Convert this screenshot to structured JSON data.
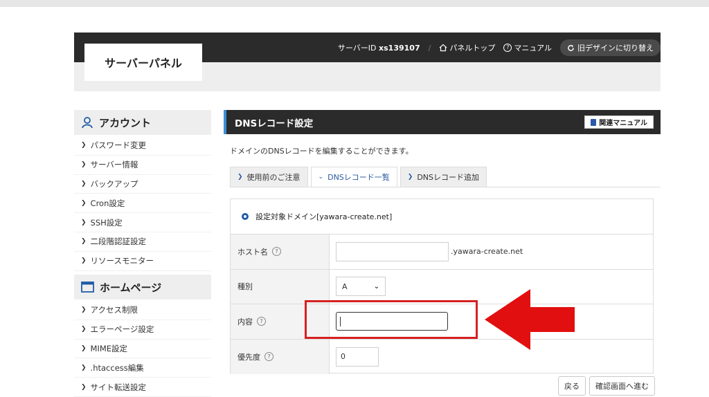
{
  "header": {
    "logo": "サーバーパネル",
    "server_id_label": "サーバーID",
    "server_id": "xs139107",
    "panel_top": "パネルトップ",
    "manual": "マニュアル",
    "old_design": "旧デザインに切り替え"
  },
  "sidebar": {
    "account_heading": "アカウント",
    "account_items": [
      "パスワード変更",
      "サーバー情報",
      "バックアップ",
      "Cron設定",
      "SSH設定",
      "二段階認証設定",
      "リソースモニター"
    ],
    "homepage_heading": "ホームページ",
    "homepage_items": [
      "アクセス制限",
      "エラーページ設定",
      "MIME設定",
      ".htaccess編集",
      "サイト転送設定"
    ]
  },
  "main": {
    "title": "DNSレコード設定",
    "related_manual": "関連マニュアル",
    "description": "ドメインのDNSレコードを編集することができます。",
    "tabs": [
      "使用前のご注意",
      "DNSレコード一覧",
      "DNSレコード追加"
    ],
    "active_tab_index": 1,
    "target_domain": "設定対象ドメイン[yawara-create.net]",
    "form": {
      "host_label": "ホスト名",
      "host_value": "",
      "host_suffix": ".yawara-create.net",
      "type_label": "種別",
      "type_value": "A",
      "content_label": "内容",
      "content_value": "",
      "priority_label": "優先度",
      "priority_value": "0"
    },
    "back_button": "戻る",
    "confirm_button": "確認画面へ進む"
  },
  "colors": {
    "dark": "#2b2b2b",
    "accent": "#1f5ba8",
    "highlight": "#d62020"
  }
}
